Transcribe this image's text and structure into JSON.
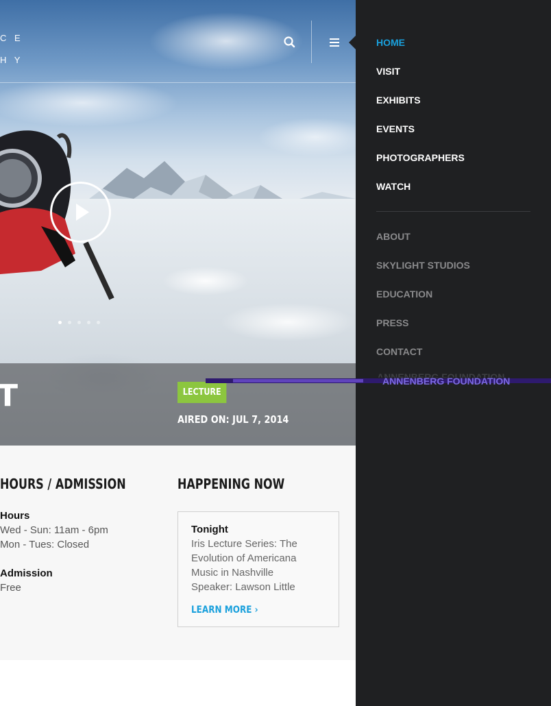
{
  "header": {
    "logo_line1": "C E",
    "logo_line2": "H Y",
    "search_icon": "search-icon",
    "menu_icon": "hamburger-menu-icon"
  },
  "hero": {
    "play_icon": "play-icon",
    "slide_count": 5,
    "active_slide": 1,
    "title_partial": "T",
    "tag": "LECTURE",
    "aired": "AIRED ON: JUL 7, 2014"
  },
  "info": {
    "hours_heading": "HOURS / ADMISSION",
    "hours_label": "Hours",
    "hours_line1": "Wed - Sun: 11am - 6pm",
    "hours_line2": "Mon - Tues: Closed",
    "admission_label": "Admission",
    "admission_value": "Free"
  },
  "happening": {
    "heading": "HAPPENING NOW",
    "title": "Tonight",
    "lines": [
      "Iris Lecture Series: The",
      "Evolution of Americana",
      "Music in Nashville",
      "Speaker: Lawson Little"
    ],
    "cta": "LEARN MORE",
    "cta_icon": "chevron-right-icon"
  },
  "nav": {
    "primary": [
      "HOME",
      "VISIT",
      "EXHIBITS",
      "EVENTS",
      "PHOTOGRAPHERS",
      "WATCH"
    ],
    "secondary": [
      "ABOUT",
      "SKYLIGHT STUDIOS",
      "EDUCATION",
      "PRESS",
      "CONTACT"
    ],
    "active": "HOME",
    "footer": "ANNENBERG FOUNDATION"
  },
  "colors": {
    "accent": "#1aa0dc",
    "tag": "#8cc63f",
    "nav_bg": "#1f2022",
    "glitch": "#6d4fd0"
  }
}
